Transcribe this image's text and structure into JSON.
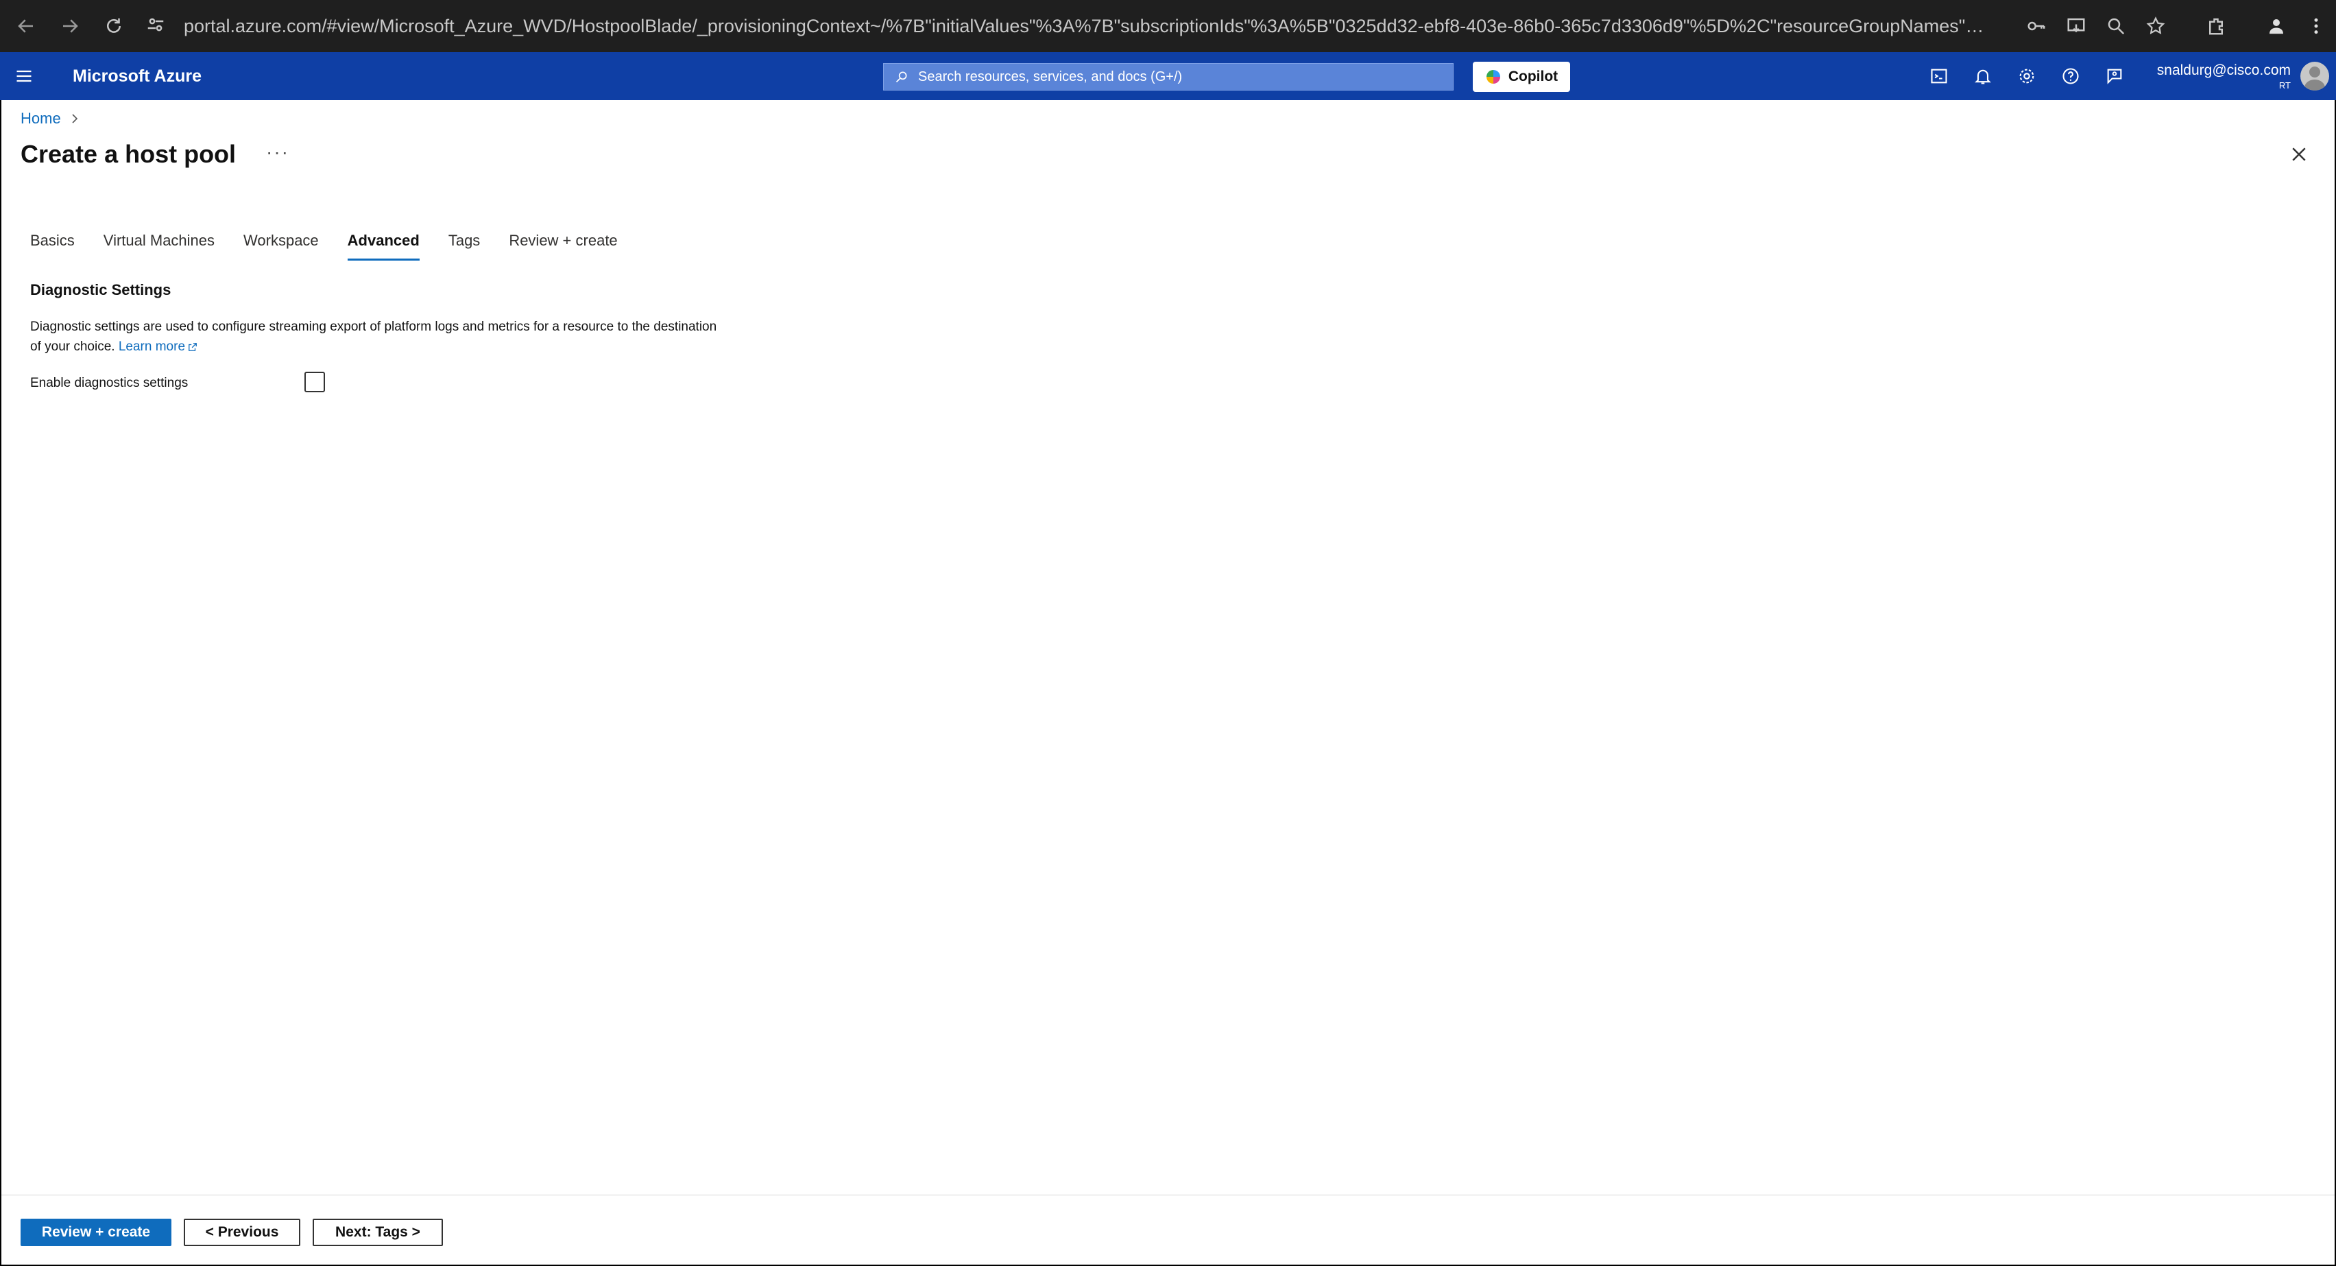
{
  "browser": {
    "url": "portal.azure.com/#view/Microsoft_Azure_WVD/HostpoolBlade/_provisioningContext~/%7B\"initialValues\"%3A%7B\"subscriptionIds\"%3A%5B\"0325dd32-ebf8-403e-86b0-365c7d3306d9\"%5D%2C\"resourceGroupNames\"%..."
  },
  "topbar": {
    "brand": "Microsoft Azure",
    "search_placeholder": "Search resources, services, and docs (G+/)",
    "copilot_label": "Copilot",
    "account_email": "snaldurg@cisco.com",
    "account_org": "RT"
  },
  "breadcrumb": {
    "home": "Home"
  },
  "page": {
    "title": "Create a host pool",
    "more": "···"
  },
  "tabs": [
    {
      "label": "Basics",
      "active": false
    },
    {
      "label": "Virtual Machines",
      "active": false
    },
    {
      "label": "Workspace",
      "active": false
    },
    {
      "label": "Advanced",
      "active": true
    },
    {
      "label": "Tags",
      "active": false
    },
    {
      "label": "Review + create",
      "active": false
    }
  ],
  "diagnostics": {
    "section_title": "Diagnostic Settings",
    "description_line1": "Diagnostic settings are used to configure streaming export of platform logs and metrics for a resource to the destination",
    "description_line2": "of your choice.",
    "learn_more": "Learn more",
    "enable_label": "Enable diagnostics settings",
    "enable_checked": false
  },
  "footer": {
    "review_create": "Review + create",
    "previous": "< Previous",
    "next": "Next: Tags >"
  },
  "colors": {
    "azure_blue": "#0f3fa5",
    "link": "#0f6cbd",
    "primary_button": "#0f6cbd"
  }
}
